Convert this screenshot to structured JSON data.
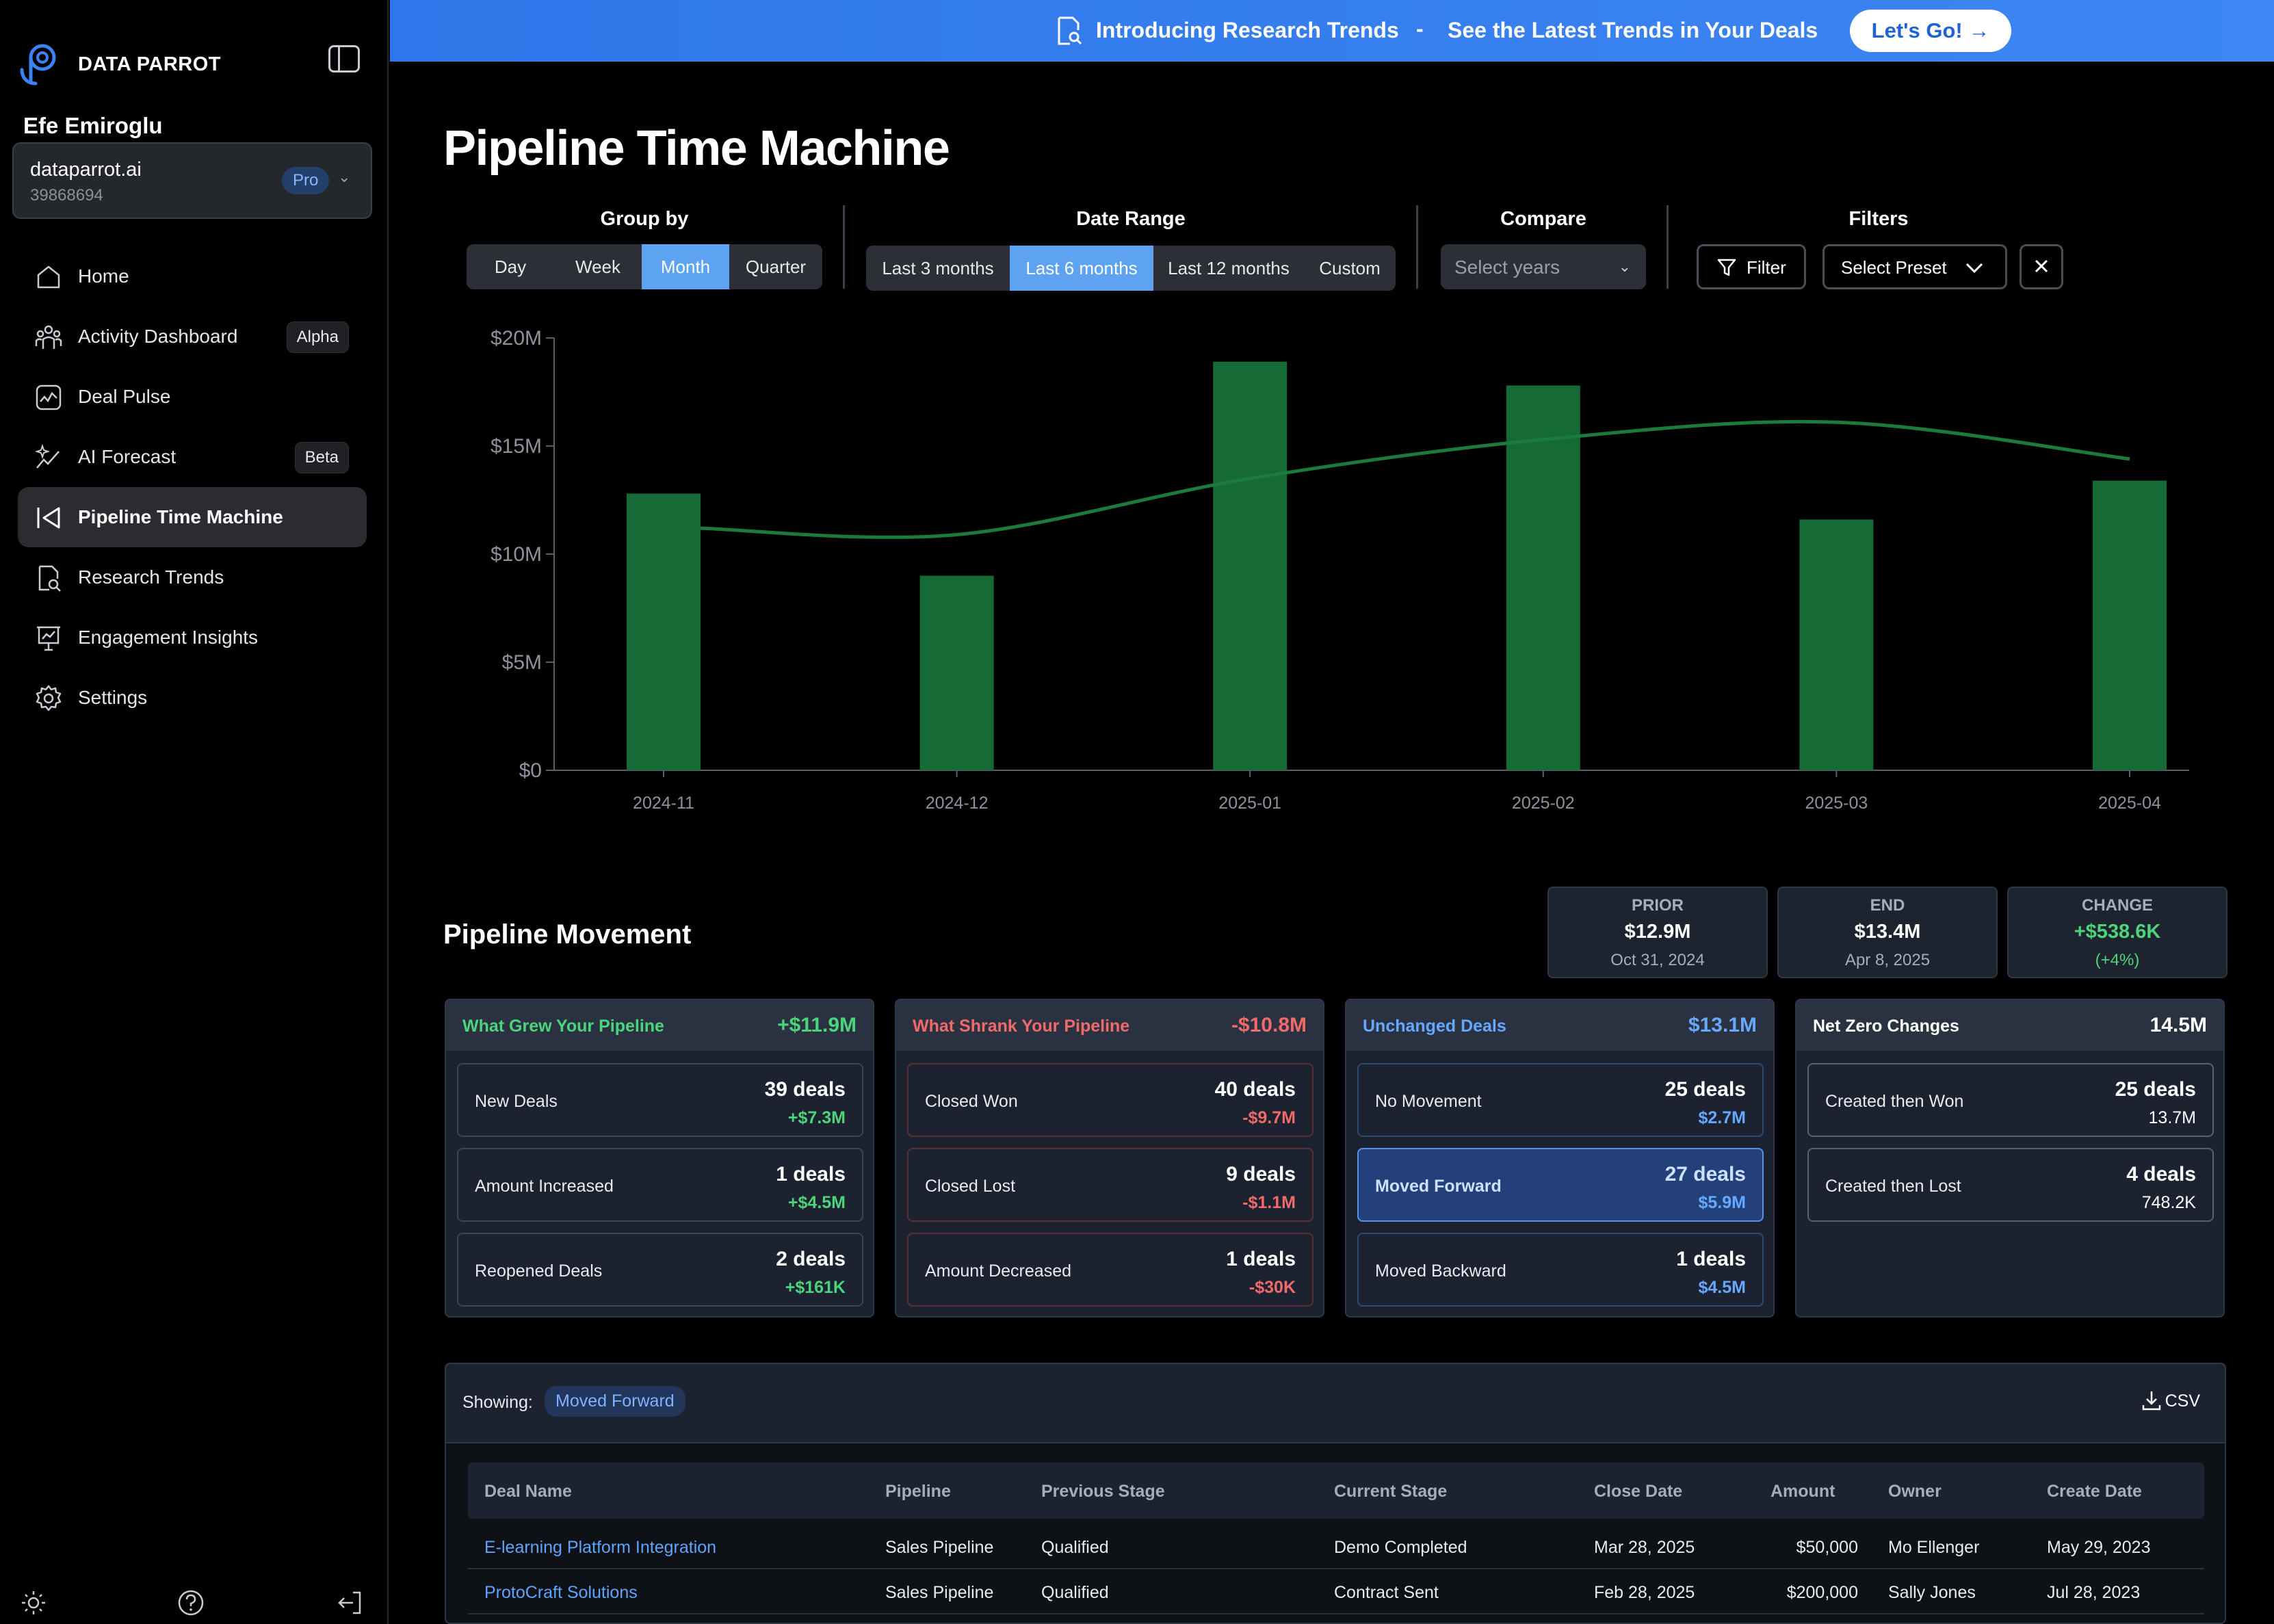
{
  "sidebar": {
    "brand": "DATA PARROT",
    "user_name": "Efe Emiroglu",
    "org": {
      "name": "dataparrot.ai",
      "id": "39868694",
      "plan": "Pro"
    },
    "items": [
      {
        "label": "Home",
        "icon": "home-icon",
        "badge": ""
      },
      {
        "label": "Activity Dashboard",
        "icon": "users-icon",
        "badge": "Alpha"
      },
      {
        "label": "Deal Pulse",
        "icon": "pulse-icon",
        "badge": ""
      },
      {
        "label": "AI Forecast",
        "icon": "sparkle-chart-icon",
        "badge": "Beta"
      },
      {
        "label": "Pipeline Time Machine",
        "icon": "rewind-icon",
        "badge": "",
        "active": true
      },
      {
        "label": "Research Trends",
        "icon": "doc-search-icon",
        "badge": ""
      },
      {
        "label": "Engagement Insights",
        "icon": "presentation-icon",
        "badge": ""
      },
      {
        "label": "Settings",
        "icon": "gear-icon",
        "badge": ""
      }
    ]
  },
  "banner": {
    "title": "Introducing Research Trends",
    "separator": "-",
    "subtitle": "See the Latest Trends in Your Deals",
    "cta": "Let's Go! →"
  },
  "page": {
    "title": "Pipeline Time Machine"
  },
  "controls": {
    "group_by": {
      "label": "Group by",
      "options": [
        "Day",
        "Week",
        "Month",
        "Quarter"
      ],
      "selected": "Month"
    },
    "date_range": {
      "label": "Date Range",
      "options": [
        "Last 3 months",
        "Last 6 months",
        "Last 12 months",
        "Custom"
      ],
      "selected": "Last 6 months"
    },
    "compare": {
      "label": "Compare",
      "placeholder": "Select years"
    },
    "filters": {
      "label": "Filters",
      "filter_btn": "Filter",
      "preset_btn": "Select Preset"
    }
  },
  "chart_data": {
    "type": "bar",
    "categories": [
      "2024-11",
      "2024-12",
      "2025-01",
      "2025-02",
      "2025-03",
      "2025-04"
    ],
    "series": [
      {
        "type": "bar",
        "values": [
          12.8,
          9.0,
          18.9,
          17.8,
          11.6,
          13.4
        ]
      },
      {
        "type": "line",
        "values": [
          11.2,
          10.9,
          13.5,
          15.3,
          16.1,
          14.4
        ]
      }
    ],
    "ylim": [
      0,
      20
    ],
    "yticks": [
      "$0",
      "$5M",
      "$10M",
      "$15M",
      "$20M"
    ],
    "bar_color": "#166a35",
    "line_color": "#1c7a3c",
    "grid": false
  },
  "movement": {
    "title": "Pipeline Movement",
    "stats": [
      {
        "label": "PRIOR",
        "value": "$12.9M",
        "sub": "Oct 31, 2024",
        "color": "#ffffff"
      },
      {
        "label": "END",
        "value": "$13.4M",
        "sub": "Apr 8, 2025",
        "color": "#ffffff"
      },
      {
        "label": "CHANGE",
        "value": "+$538.6K",
        "sub": "(+4%)",
        "color": "#4cd47a"
      }
    ],
    "cards": [
      {
        "title": "What Grew Your Pipeline",
        "total": "+$11.9M",
        "tone": "green",
        "rows": [
          {
            "label": "New Deals",
            "count": "39 deals",
            "amount": "+$7.3M"
          },
          {
            "label": "Amount Increased",
            "count": "1 deals",
            "amount": "+$4.5M"
          },
          {
            "label": "Reopened Deals",
            "count": "2 deals",
            "amount": "+$161K"
          }
        ]
      },
      {
        "title": "What Shrank Your Pipeline",
        "total": "-$10.8M",
        "tone": "red",
        "rows": [
          {
            "label": "Closed Won",
            "count": "40 deals",
            "amount": "-$9.7M"
          },
          {
            "label": "Closed Lost",
            "count": "9 deals",
            "amount": "-$1.1M"
          },
          {
            "label": "Amount Decreased",
            "count": "1 deals",
            "amount": "-$30K"
          }
        ]
      },
      {
        "title": "Unchanged Deals",
        "total": "$13.1M",
        "tone": "blue",
        "rows": [
          {
            "label": "No Movement",
            "count": "25 deals",
            "amount": "$2.7M"
          },
          {
            "label": "Moved Forward",
            "count": "27 deals",
            "amount": "$5.9M",
            "selected": true
          },
          {
            "label": "Moved Backward",
            "count": "1 deals",
            "amount": "$4.5M"
          }
        ]
      },
      {
        "title": "Net Zero Changes",
        "total": "14.5M",
        "tone": "white",
        "rows": [
          {
            "label": "Created then Won",
            "count": "25 deals",
            "amount": "13.7M"
          },
          {
            "label": "Created then Lost",
            "count": "4 deals",
            "amount": "748.2K"
          }
        ]
      }
    ]
  },
  "table": {
    "showing_label": "Showing:",
    "showing_value": "Moved Forward",
    "csv_label": "CSV",
    "columns": [
      "Deal Name",
      "Pipeline",
      "Previous Stage",
      "Current Stage",
      "Close Date",
      "Amount",
      "Owner",
      "Create Date"
    ],
    "rows": [
      [
        "E-learning Platform Integration",
        "Sales Pipeline",
        "Qualified",
        "Demo Completed",
        "Mar 28, 2025",
        "$50,000",
        "Mo Ellenger",
        "May 29, 2023"
      ],
      [
        "ProtoCraft Solutions",
        "Sales Pipeline",
        "Qualified",
        "Contract Sent",
        "Feb 28, 2025",
        "$200,000",
        "Sally Jones",
        "Jul 28, 2023"
      ]
    ]
  }
}
